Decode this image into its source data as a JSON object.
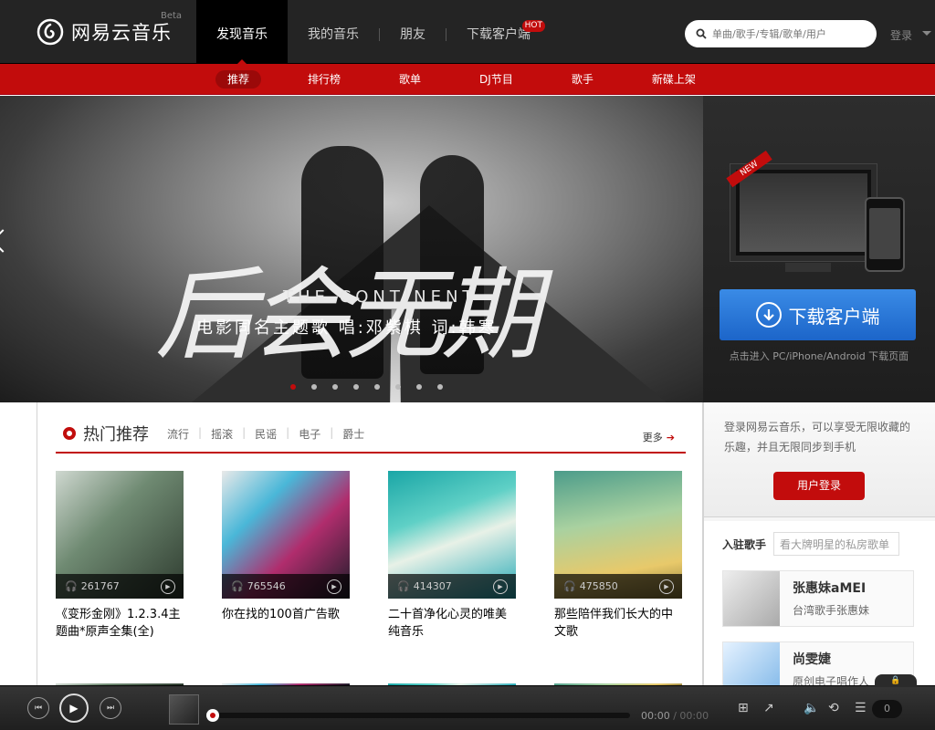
{
  "header": {
    "logo_text": "网易云音乐",
    "beta": "Beta",
    "nav": [
      {
        "label": "发现音乐"
      },
      {
        "label": "我的音乐"
      },
      {
        "label": "朋友"
      },
      {
        "label": "下载客户端",
        "badge": "HOT"
      }
    ],
    "search_placeholder": "单曲/歌手/专辑/歌单/用户",
    "login": "登录"
  },
  "subnav": [
    "推荐",
    "排行榜",
    "歌单",
    "DJ节目",
    "歌手",
    "新碟上架"
  ],
  "banner": {
    "title": "后会无期",
    "subtitle": "THE CONTINENT",
    "caption": "电影同名主题歌  唱:邓紫棋  词:韩寒",
    "dots": 8,
    "active_dot": 0
  },
  "download": {
    "new_tag": "NEW",
    "button": "下载客户端",
    "note": "点击进入 PC/iPhone/Android 下载页面"
  },
  "hot": {
    "title": "热门推荐",
    "tags": [
      "流行",
      "摇滚",
      "民谣",
      "电子",
      "爵士"
    ],
    "more": "更多"
  },
  "playlists": [
    {
      "title": "《变形金刚》1.2.3.4主题曲*原声全集(全)",
      "plays": "261767"
    },
    {
      "title": "你在找的100首广告歌",
      "plays": "765546"
    },
    {
      "title": "二十首净化心灵的唯美纯音乐",
      "plays": "414307"
    },
    {
      "title": "那些陪伴我们长大的中文歌",
      "plays": "475850"
    }
  ],
  "sidebar": {
    "login_text": "登录网易云音乐，可以享受无限收藏的乐趣，并且无限同步到手机",
    "login_button": "用户登录",
    "artists_title": "入驻歌手",
    "artists_search": "看大牌明星的私房歌单",
    "artists": [
      {
        "name": "张惠妹aMEI",
        "desc": "台湾歌手张惠妹"
      },
      {
        "name": "尚雯婕",
        "desc": "原创电子唱作人"
      }
    ]
  },
  "player": {
    "time_current": "00:00",
    "time_total": "00:00",
    "progress": 0,
    "playlist_count": "0"
  }
}
